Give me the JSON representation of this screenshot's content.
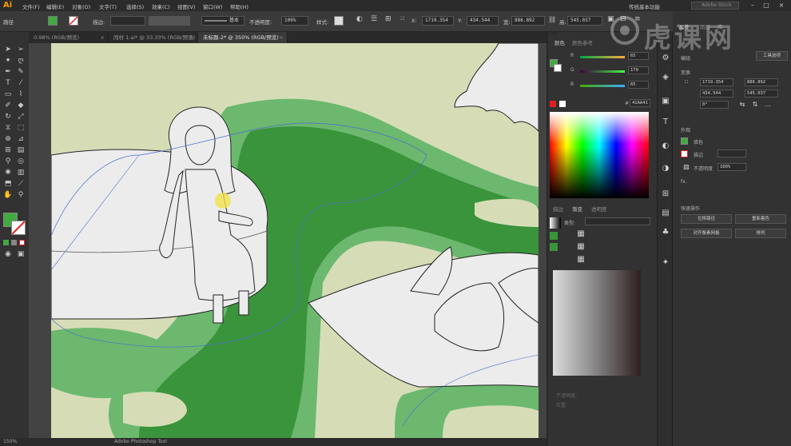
{
  "menubar": {
    "logo": "Ai",
    "items": [
      "文件(F)",
      "编辑(E)",
      "对象(O)",
      "文字(T)",
      "选择(S)",
      "效果(C)",
      "视图(V)",
      "窗口(W)",
      "帮助(H)"
    ],
    "workspace": "传统基本功能",
    "search_placeholder": "Adobe Stock",
    "user_label": "选择"
  },
  "ctrlbar": {
    "mode_label": "路径",
    "stroke_label": "描边:",
    "stroke_style": "基本",
    "opacity_label": "不透明度:",
    "opacity_value": "100%",
    "style_label": "样式:",
    "x_label": "X:",
    "x_value": "1719.354",
    "y_label": "Y:",
    "y_value": "434.544",
    "w_label": "宽:",
    "w_value": "886.892",
    "h_label": "高:",
    "h_value": "545.037"
  },
  "tabs": [
    {
      "label": "0.98% (RGB/预览)"
    },
    {
      "label": "闯村 1.ai* @ 33.33% (RGB/预览)"
    },
    {
      "label": "未标题-2* @ 350% (RGB/预览)"
    }
  ],
  "status": {
    "zoom": "150%",
    "tool_name": "Adobe Photoshop Tool"
  },
  "colorpanel": {
    "tab_color": "颜色",
    "tab_guide": "颜色参考",
    "r_value": "65",
    "g_value": "170",
    "b_value": "65",
    "hex_value": "41AA41",
    "hash_label": "#"
  },
  "gradpanel": {
    "tab_stroke": "描边",
    "tab_gradient": "渐变",
    "tab_transparency": "透明度",
    "type_label": "类型:",
    "opacity_label": "不透明度:",
    "location_label": "位置:"
  },
  "props": {
    "tab_props": "属性",
    "tab_layers": "图层",
    "tab_lib": "库",
    "section_transform": "变换",
    "group_label": "编组",
    "x_value": "1719.354",
    "y_value": "434.544",
    "w_value": "886.892",
    "h_value": "545.037",
    "angle_value": "0°",
    "section_appearance": "外观",
    "fill_label": "填色",
    "stroke_label": "描边",
    "opacity_label": "不透明度",
    "opacity_value": "100%",
    "fx_label": "fx.",
    "section_quick": "快速操作",
    "btn_offset": "位移路径",
    "btn_recolor": "重新着色",
    "btn_align_grid": "对齐像素网格",
    "btn_arrange": "排列",
    "start_btn": "工具选项"
  },
  "watermark": "虎课网",
  "colors": {
    "accent_green": "#41aa41",
    "dark_green": "#3a943b",
    "light_green": "#6cb86f",
    "bg_cream": "#d6ddb6",
    "object_white": "#ececec"
  }
}
